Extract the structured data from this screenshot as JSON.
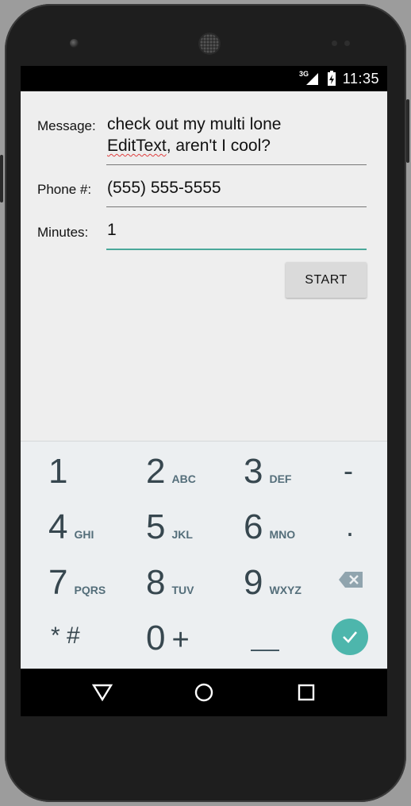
{
  "status_bar": {
    "network": "3G",
    "time": "11:35"
  },
  "form": {
    "message": {
      "label": "Message:",
      "value_line1": "check out my multi lone",
      "value_line2_misspelled": "EditText",
      "value_line2_rest": ", aren't I cool?"
    },
    "phone": {
      "label": "Phone #:",
      "value": "(555) 555-5555"
    },
    "minutes": {
      "label": "Minutes:",
      "value": "1"
    },
    "start_button": "START"
  },
  "keyboard": {
    "keys": [
      {
        "num": "1",
        "letters": ""
      },
      {
        "num": "2",
        "letters": "ABC"
      },
      {
        "num": "3",
        "letters": "DEF"
      },
      {
        "num": "4",
        "letters": "GHI"
      },
      {
        "num": "5",
        "letters": "JKL"
      },
      {
        "num": "6",
        "letters": "MNO"
      },
      {
        "num": "7",
        "letters": "PQRS"
      },
      {
        "num": "8",
        "letters": "TUV"
      },
      {
        "num": "9",
        "letters": "WXYZ"
      },
      {
        "num": "0",
        "letters": "+"
      }
    ],
    "dash": "-",
    "dot": ".",
    "star_hash": "* #",
    "space": "__",
    "icons": {
      "delete": "backspace-icon",
      "done": "checkmark-icon"
    },
    "colors": {
      "done": "#4db6ac",
      "active_underline": "#4aa89a"
    }
  },
  "nav_bar": {
    "icons": [
      "back-triangle-icon",
      "home-circle-icon",
      "recents-square-icon"
    ]
  }
}
